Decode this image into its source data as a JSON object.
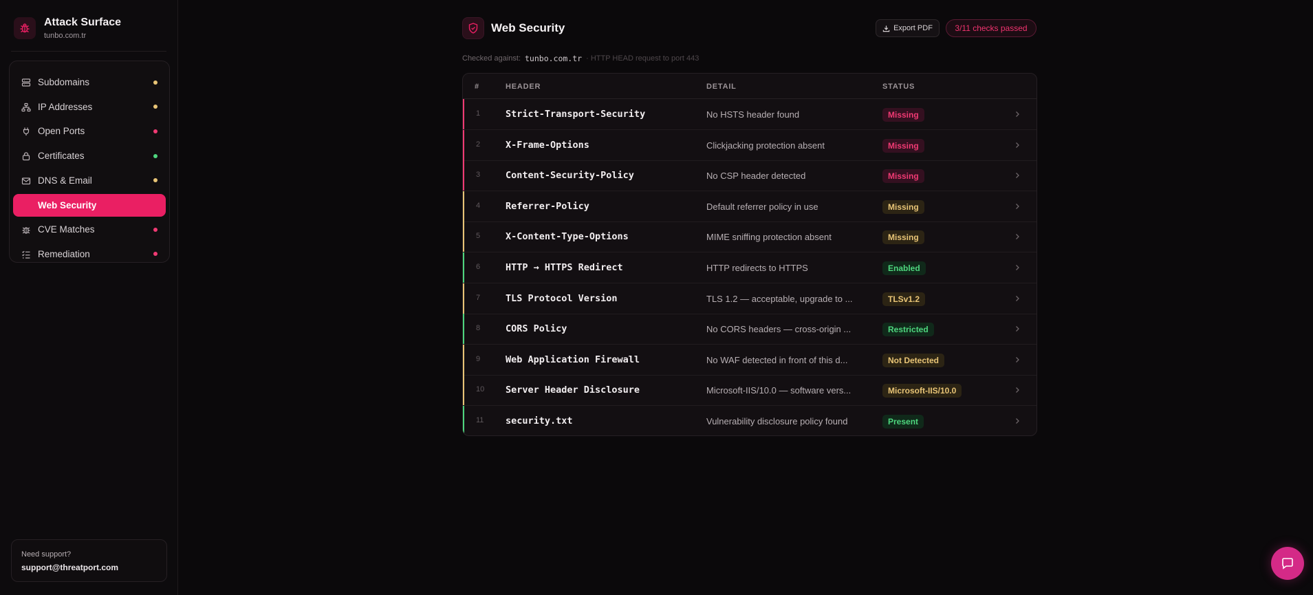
{
  "sidebar": {
    "brand_title": "Attack Surface",
    "brand_domain": "tunbo.com.tr",
    "items": [
      {
        "label": "Subdomains",
        "icon": "server-icon",
        "status_color": "#e8c476"
      },
      {
        "label": "IP Addresses",
        "icon": "network-icon",
        "status_color": "#e8c476"
      },
      {
        "label": "Open Ports",
        "icon": "plug-icon",
        "status_color": "#f03a73"
      },
      {
        "label": "Certificates",
        "icon": "lock-icon",
        "status_color": "#4ed67e"
      },
      {
        "label": "DNS & Email",
        "icon": "mail-icon",
        "status_color": "#e8c476"
      },
      {
        "label": "Web Security",
        "icon": "shield-icon",
        "active": true
      },
      {
        "label": "CVE Matches",
        "icon": "bug-icon",
        "status_color": "#f03a73"
      },
      {
        "label": "Remediation",
        "icon": "checklist-icon",
        "status_color": "#f03a73"
      }
    ],
    "support_question": "Need support?",
    "support_email": "support@threatport.com"
  },
  "header": {
    "title": "Web Security",
    "export_label": "Export PDF",
    "score": "3/11 checks passed",
    "checked_label": "Checked against:",
    "checked_domain": "tunbo.com.tr",
    "checked_method": "· HTTP HEAD request to port 443"
  },
  "table": {
    "columns": [
      "#",
      "HEADER",
      "DETAIL",
      "STATUS"
    ],
    "rows": [
      {
        "num": "1",
        "header": "Strict-Transport-Security",
        "detail": "No HSTS header found",
        "status": "Missing",
        "severity": "red"
      },
      {
        "num": "2",
        "header": "X-Frame-Options",
        "detail": "Clickjacking protection absent",
        "status": "Missing",
        "severity": "red"
      },
      {
        "num": "3",
        "header": "Content-Security-Policy",
        "detail": "No CSP header detected",
        "status": "Missing",
        "severity": "red"
      },
      {
        "num": "4",
        "header": "Referrer-Policy",
        "detail": "Default referrer policy in use",
        "status": "Missing",
        "severity": "yellow"
      },
      {
        "num": "5",
        "header": "X-Content-Type-Options",
        "detail": "MIME sniffing protection absent",
        "status": "Missing",
        "severity": "yellow"
      },
      {
        "num": "6",
        "header": "HTTP → HTTPS Redirect",
        "detail": "HTTP redirects to HTTPS",
        "status": "Enabled",
        "severity": "green"
      },
      {
        "num": "7",
        "header": "TLS Protocol Version",
        "detail": "TLS 1.2 — acceptable, upgrade to ...",
        "status": "TLSv1.2",
        "severity": "yellow"
      },
      {
        "num": "8",
        "header": "CORS Policy",
        "detail": "No CORS headers — cross-origin ...",
        "status": "Restricted",
        "severity": "green"
      },
      {
        "num": "9",
        "header": "Web Application Firewall",
        "detail": "No WAF detected in front of this d...",
        "status": "Not Detected",
        "severity": "yellow"
      },
      {
        "num": "10",
        "header": "Server Header Disclosure",
        "detail": "Microsoft-IIS/10.0 — software vers...",
        "status": "Microsoft-IIS/10.0",
        "severity": "yellow"
      },
      {
        "num": "11",
        "header": "security.txt",
        "detail": "Vulnerability disclosure policy found",
        "status": "Present",
        "severity": "green"
      }
    ]
  },
  "colors": {
    "accent": "#ea1f63",
    "red": "#f03a73",
    "yellow": "#e8c476",
    "green": "#4ed67e"
  },
  "chat_icon": "chat-icon"
}
